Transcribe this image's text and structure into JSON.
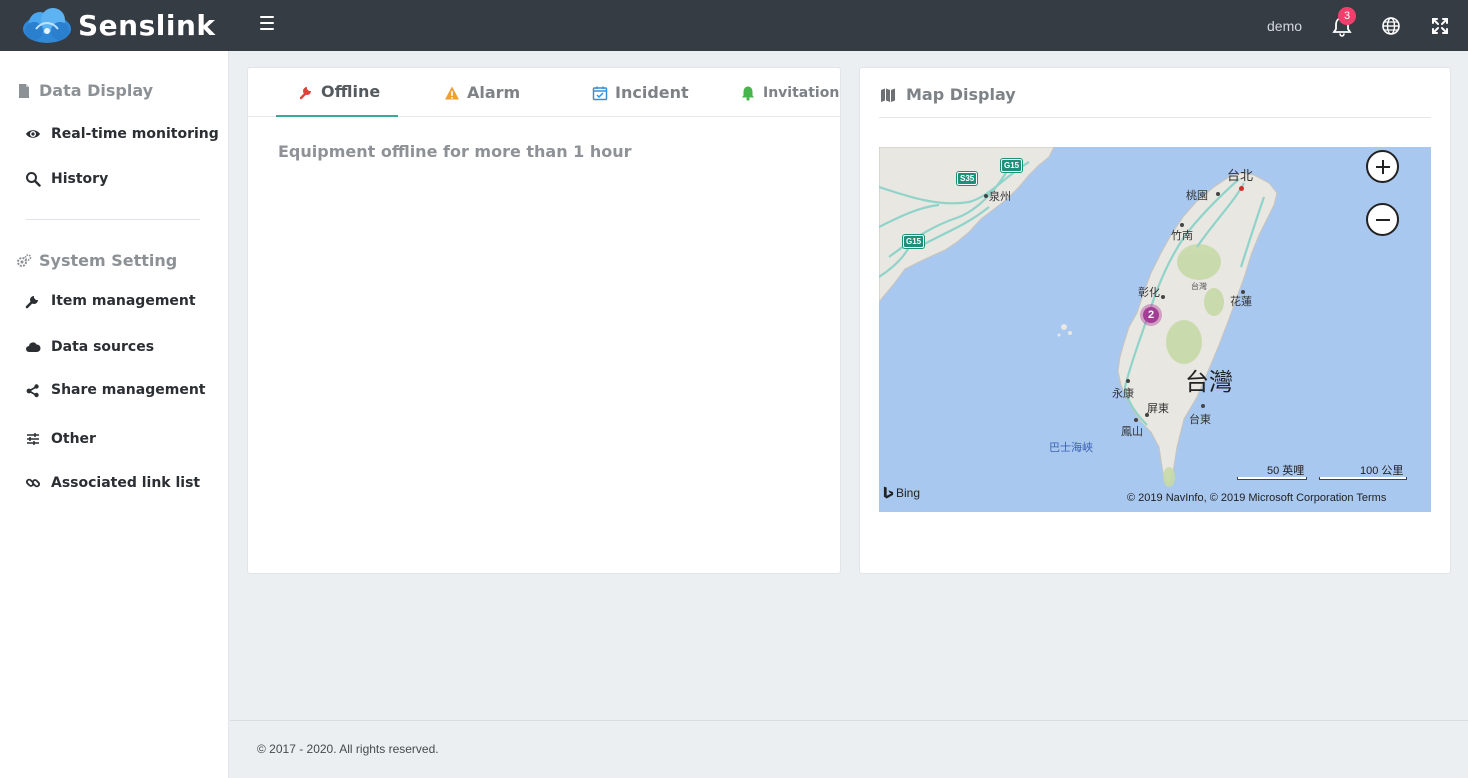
{
  "header": {
    "brand": "Senslink",
    "user": "demo",
    "notification_count": "3"
  },
  "sidebar": {
    "sections": [
      {
        "title": "Data Display",
        "icon": "document-icon"
      },
      {
        "title": "System Setting",
        "icon": "gears-icon"
      }
    ],
    "items": [
      {
        "label": "Real-time monitoring",
        "icon": "eye-icon"
      },
      {
        "label": "History",
        "icon": "search-icon"
      },
      {
        "label": "Item management",
        "icon": "wrench-icon"
      },
      {
        "label": "Data sources",
        "icon": "cloud-icon"
      },
      {
        "label": "Share management",
        "icon": "share-icon"
      },
      {
        "label": "Other",
        "icon": "sliders-icon"
      },
      {
        "label": "Associated link list",
        "icon": "link-icon"
      }
    ]
  },
  "tabs": [
    {
      "label": "Offline",
      "icon": "wrench-icon",
      "active": true,
      "color": "#e0433b"
    },
    {
      "label": "Alarm",
      "icon": "warning-icon",
      "active": false,
      "color": "#f0a030"
    },
    {
      "label": "Incident",
      "icon": "calendar-check-icon",
      "active": false,
      "color": "#3a8fd6"
    },
    {
      "label": "Invitation",
      "icon": "bell-icon",
      "active": false,
      "color": "#47b54b"
    }
  ],
  "offline": {
    "description": "Equipment offline for more than 1 hour"
  },
  "map_panel": {
    "title": "Map Display",
    "cluster_count": "2",
    "places": {
      "taipei": "台北",
      "taoyuan": "桃園",
      "quanzhou": "泉州",
      "zhunan": "竹南",
      "changhua": "彰化",
      "nantou": "台灣",
      "hualien": "花蓮",
      "taiwan": "台灣",
      "yongkang": "永康",
      "pingtung": "屏東",
      "taitung": "台東",
      "fengshan": "鳳山",
      "bashi": "巴士海峽"
    },
    "highways": [
      "G15",
      "S35",
      "G15",
      "G15"
    ],
    "scale_miles": "50 英哩",
    "scale_km": "100 公里",
    "bing": "Bing",
    "copyright": "© 2019 NavInfo, © 2019 Microsoft Corporation  Terms"
  },
  "footer": {
    "text": "© 2017 - 2020. All rights reserved."
  },
  "colors": {
    "header_bg": "#363c44",
    "accent": "#3aa99a",
    "badge": "#ef3f6c",
    "cluster": "#a43d96"
  }
}
